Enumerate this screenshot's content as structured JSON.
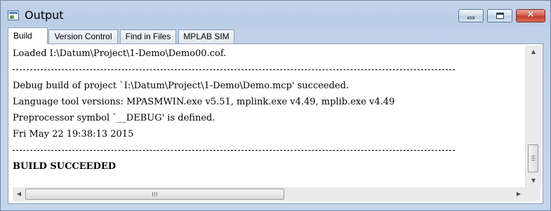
{
  "window": {
    "title": "Output",
    "controls": {
      "minimize": "minimize",
      "maximize": "maximize",
      "close_label": "✕"
    }
  },
  "tabs": [
    {
      "label": "Build",
      "active": true
    },
    {
      "label": "Version Control",
      "active": false
    },
    {
      "label": "Find in Files",
      "active": false
    },
    {
      "label": "MPLAB SIM",
      "active": false
    }
  ],
  "output": {
    "lines": [
      "Loaded I:\\Datum\\Project\\1-Demo\\Demo00.cof.",
      "Debug build of project `I:\\Datum\\Project\\1-Demo\\Demo.mcp' succeeded.",
      "Language tool versions: MPASMWIN.exe v5.51, mplink.exe v4.49, mplib.exe v4.49",
      "Preprocessor symbol `__DEBUG' is defined.",
      "Fri May 22 19:38:13 2015",
      "BUILD SUCCEEDED"
    ]
  },
  "scrollbars": {
    "vertical": {
      "up_icon": "▲",
      "down_icon": "▼",
      "position": 0.72
    },
    "horizontal": {
      "left_icon": "◀",
      "right_icon": "▶",
      "position": 0.0
    }
  },
  "colors": {
    "titlebar": "#b9cde6",
    "close_button": "#c13b2b",
    "panel_bg": "#ffffff"
  }
}
